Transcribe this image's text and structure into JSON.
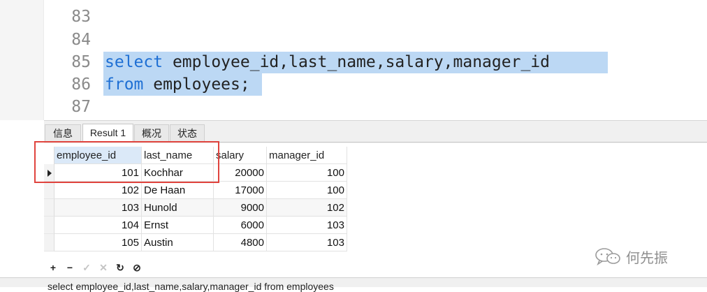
{
  "editor": {
    "lines": [
      {
        "num": "83",
        "text": ""
      },
      {
        "num": "84",
        "text": ""
      },
      {
        "num": "85",
        "keyword": "select",
        "rest": " employee_id,last_name,salary,manager_id"
      },
      {
        "num": "86",
        "keyword": "from",
        "rest": " employees;"
      },
      {
        "num": "87",
        "text": ""
      }
    ]
  },
  "tabs": [
    {
      "label": "信息",
      "active": false
    },
    {
      "label": "Result 1",
      "active": true
    },
    {
      "label": "概况",
      "active": false
    },
    {
      "label": "状态",
      "active": false
    }
  ],
  "result": {
    "columns": [
      "employee_id",
      "last_name",
      "salary",
      "manager_id"
    ],
    "rows": [
      [
        "101",
        "Kochhar",
        "20000",
        "100"
      ],
      [
        "102",
        "De Haan",
        "17000",
        "100"
      ],
      [
        "103",
        "Hunold",
        "9000",
        "102"
      ],
      [
        "104",
        "Ernst",
        "6000",
        "103"
      ],
      [
        "105",
        "Austin",
        "4800",
        "103"
      ]
    ],
    "current_row_index": 0
  },
  "toolbar": {
    "add": "+",
    "delete": "−",
    "apply": "✓",
    "cancel": "✕",
    "refresh": "↻",
    "stop": "⊘"
  },
  "watermark": {
    "text": "何先振",
    "icon": "wechat-icon"
  },
  "statusbar": {
    "text": "select employee_id,last_name,salary,manager_id  from employees"
  },
  "colors": {
    "selection": "#bcd8f4",
    "keyword": "#1e6fd4",
    "highlight_box": "#e0443e"
  }
}
